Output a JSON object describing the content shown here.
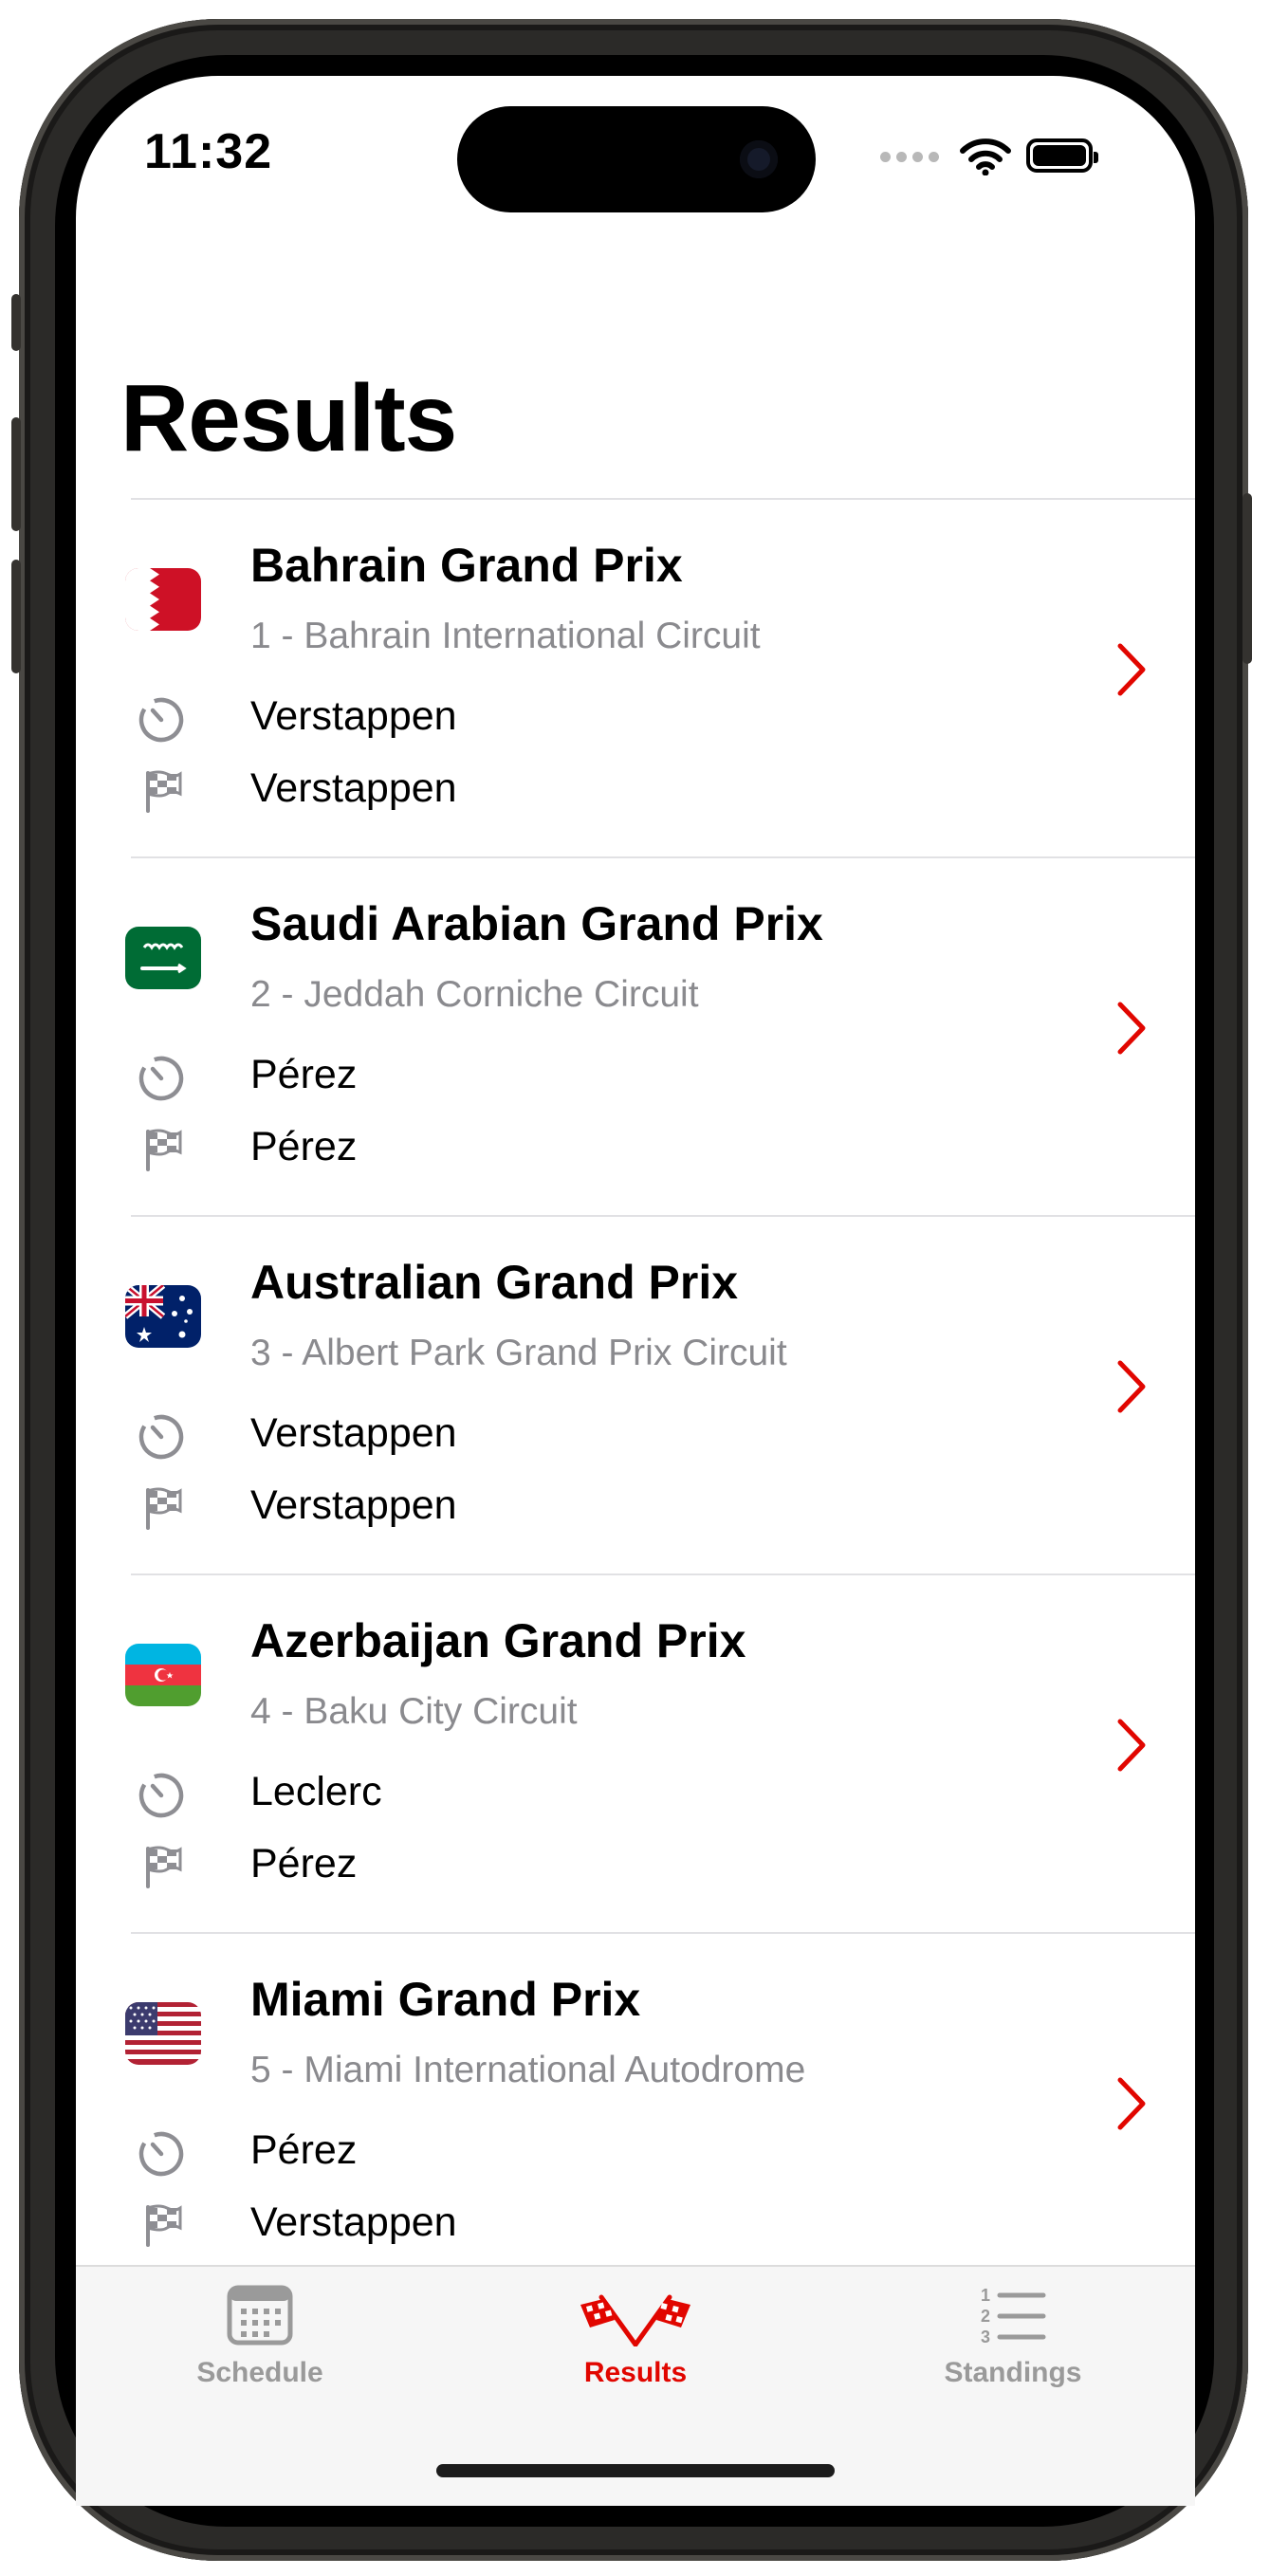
{
  "status_bar": {
    "time": "11:32"
  },
  "header": {
    "title": "Results"
  },
  "races": [
    {
      "name": "Bahrain Grand Prix",
      "subtitle": "1 - Bahrain International Circuit",
      "pole": "Verstappen",
      "winner": "Verstappen",
      "flag": "bahrain-flag-icon"
    },
    {
      "name": "Saudi Arabian Grand Prix",
      "subtitle": "2 - Jeddah Corniche Circuit",
      "pole": "Pérez",
      "winner": "Pérez",
      "flag": "saudi-arabia-flag-icon"
    },
    {
      "name": "Australian Grand Prix",
      "subtitle": "3 - Albert Park Grand Prix Circuit",
      "pole": "Verstappen",
      "winner": "Verstappen",
      "flag": "australia-flag-icon"
    },
    {
      "name": "Azerbaijan Grand Prix",
      "subtitle": "4 - Baku City Circuit",
      "pole": "Leclerc",
      "winner": "Pérez",
      "flag": "azerbaijan-flag-icon"
    },
    {
      "name": "Miami Grand Prix",
      "subtitle": "5 - Miami International Autodrome",
      "pole": "Pérez",
      "winner": "Verstappen",
      "flag": "usa-flag-icon"
    }
  ],
  "tabs": [
    {
      "label": "Schedule",
      "icon": "calendar-icon",
      "active": false
    },
    {
      "label": "Results",
      "icon": "checkered-flags-icon",
      "active": true
    },
    {
      "label": "Standings",
      "icon": "numbered-list-icon",
      "active": false
    }
  ],
  "colors": {
    "accent": "#e10600",
    "secondary_text": "#8a8a8e",
    "icon_gray": "#8e8e93"
  }
}
